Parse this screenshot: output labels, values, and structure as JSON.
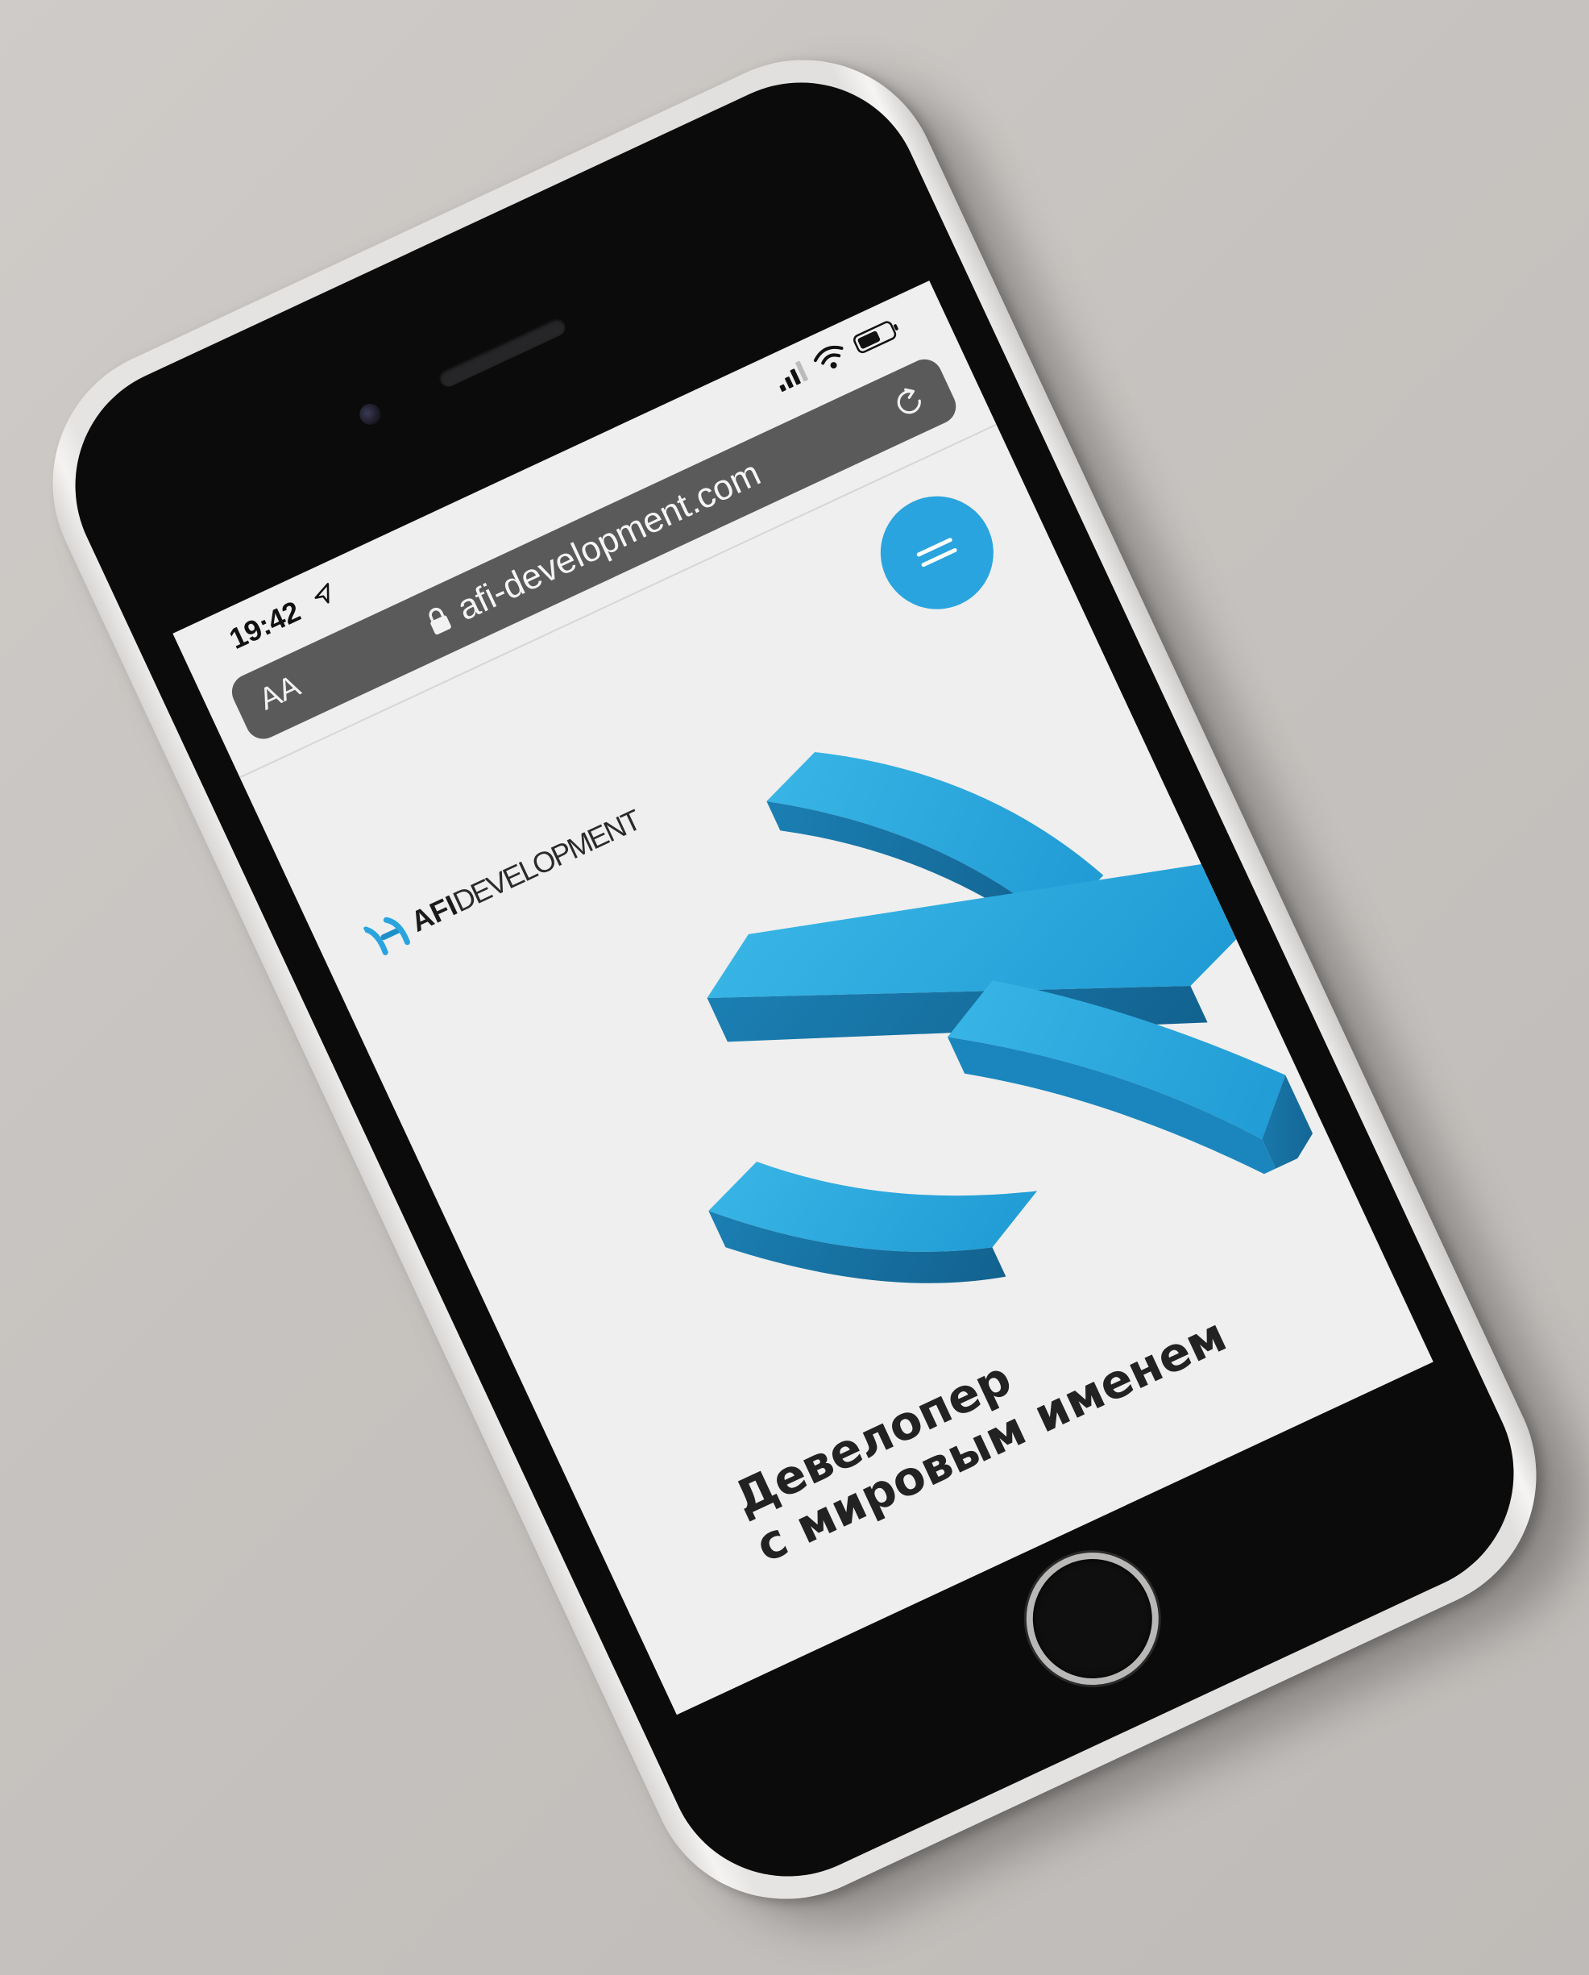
{
  "status_bar": {
    "time": "19:42",
    "icons": [
      "location-arrow-icon",
      "signal-icon",
      "wifi-icon",
      "battery-icon"
    ]
  },
  "browser": {
    "text_size_label": "AA",
    "url": "afi-development.com",
    "icons": [
      "lock-icon",
      "reload-icon"
    ]
  },
  "site": {
    "logo": {
      "brand": "AFI",
      "rest": "DEVELOPMENT"
    },
    "menu_icon": "menu-icon",
    "tagline_line1": "Девелопер",
    "tagline_line2": "с мировым именем"
  },
  "colors": {
    "accent": "#2aa4de",
    "url_bar_bg": "#5a5a5a",
    "screen_bg": "#efefef"
  }
}
